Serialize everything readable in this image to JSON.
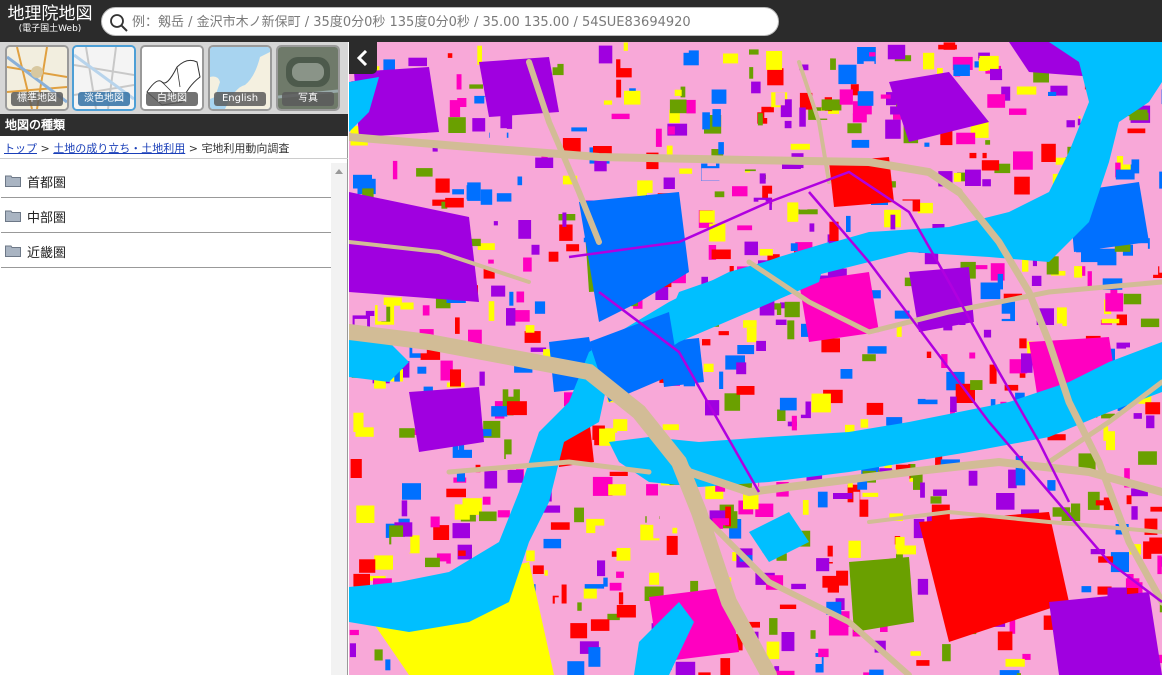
{
  "header": {
    "logo_title": "地理院地図",
    "logo_subtitle": "(電子国土Web)",
    "search_placeholder": "例：剱岳 / 金沢市木ノ新保町 / 35度0分0秒 135度0分0秒 / 35.00 135.00 / 54SUE83694920"
  },
  "map_tiles": [
    {
      "label": "標準地図",
      "selected": false
    },
    {
      "label": "淡色地図",
      "selected": true
    },
    {
      "label": "白地図",
      "selected": false
    },
    {
      "label": "English",
      "selected": false
    },
    {
      "label": "写真",
      "selected": false
    }
  ],
  "panel": {
    "title": "地図の種類",
    "breadcrumb": {
      "top": "トップ",
      "sep": ">",
      "category": "土地の成り立ち・土地利用",
      "current": "宅地利用動向調査"
    },
    "items": [
      {
        "label": "首都圏"
      },
      {
        "label": "中部圏"
      },
      {
        "label": "近畿圏"
      }
    ]
  },
  "colors": {
    "header_bg": "#2b2b2b",
    "river": "#00bfff",
    "residential": "#f8a8d8",
    "commercial": "#ff0000",
    "industrial": "#a000e0",
    "public": "#0070ff",
    "green": "#6aa000",
    "vacant": "#ffff00",
    "road": "#d2bc96",
    "mixed": "#ff00c0"
  }
}
